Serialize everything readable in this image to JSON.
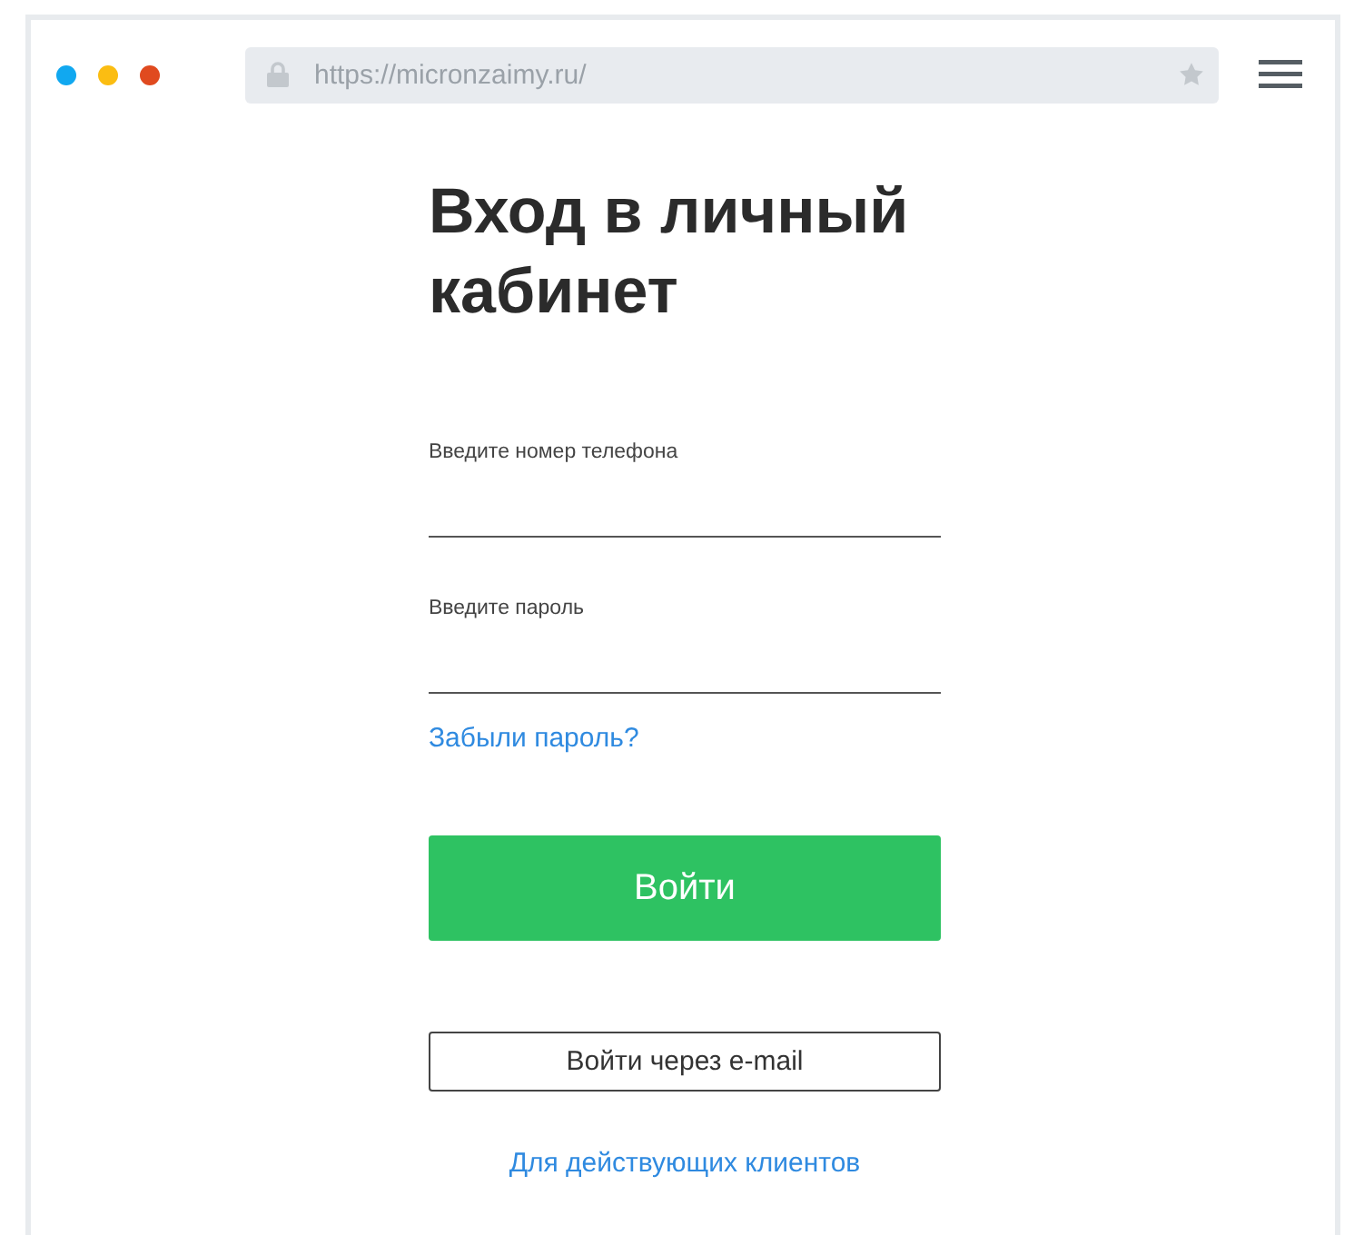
{
  "browser": {
    "url": "https://micronzaimy.ru/",
    "dots": [
      {
        "color": "#11a8f0"
      },
      {
        "color": "#fbbd12"
      },
      {
        "color": "#e04a1f"
      }
    ]
  },
  "login": {
    "title": "Вход в личный кабинет",
    "fields": [
      {
        "label": "Введите номер телефона"
      },
      {
        "label": "Введите пароль"
      }
    ],
    "forgot_link": "Забыли пароль?",
    "submit_button": "Войти",
    "email_button": "Войти через e-mail",
    "clients_link": "Для действующих клиентов"
  }
}
